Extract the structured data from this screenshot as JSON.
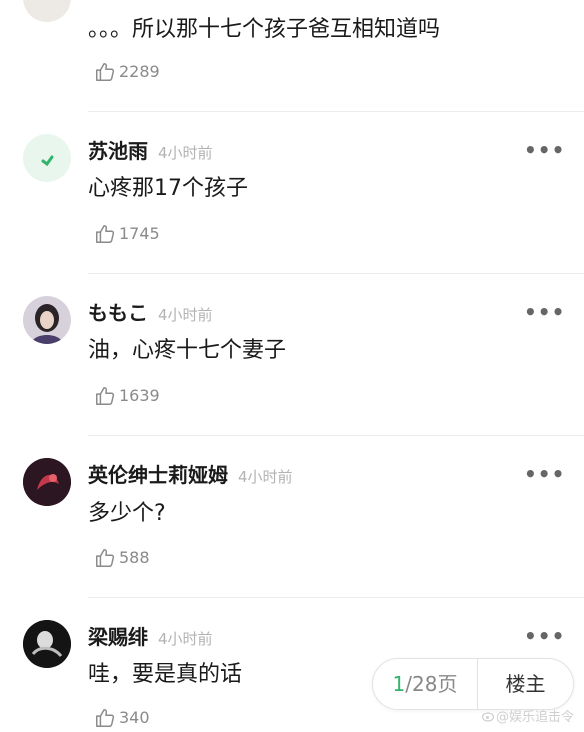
{
  "comments": [
    {
      "content": "。。。所以那十七个孩子爸互相知道吗",
      "likes": "2289"
    },
    {
      "username": "苏池雨",
      "time": "4小时前",
      "content": "心疼那17个孩子",
      "likes": "1745",
      "more": "•••",
      "avatar_color": "#e8f6ee"
    },
    {
      "username": "ももこ",
      "time": "4小时前",
      "content": "油，心疼十七个妻子",
      "likes": "1639",
      "more": "•••",
      "avatar_color": "#c9c3cf"
    },
    {
      "username": "英伦绅士莉娅姆",
      "time": "4小时前",
      "content": "多少个?",
      "likes": "588",
      "more": "•••",
      "avatar_color": "#3a1d2a"
    },
    {
      "username": "梁赐绯",
      "time": "4小时前",
      "content": "哇，要是真的话",
      "likes": "340",
      "more": "•••",
      "avatar_color": "#1c1c1c"
    }
  ],
  "pager": {
    "current": "1",
    "total": "/28页",
    "owner_label": "楼主"
  },
  "watermark": "@娱乐追击令",
  "colors": {
    "accent": "#33b36b",
    "time_gray": "#b3b3b3",
    "like_gray": "#8a8a8a"
  },
  "icons": {
    "like": "thumbs-up-icon",
    "more": "more-dots-icon",
    "weibo": "weibo-logo-icon"
  }
}
